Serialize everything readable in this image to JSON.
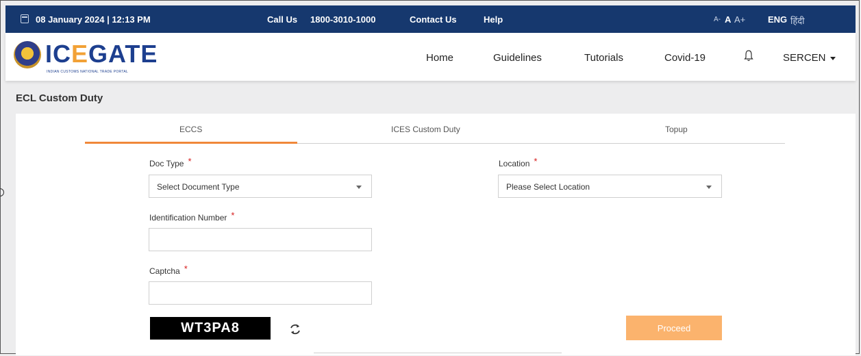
{
  "topbar": {
    "datetime": "08 January 2024 | 12:13 PM",
    "call_label": "Call Us",
    "call_number": "1800-3010-1000",
    "contact": "Contact Us",
    "help": "Help",
    "font_small": "A-",
    "font_normal": "A",
    "font_large": "A+",
    "lang_en": "ENG",
    "lang_hi": "हिंदी"
  },
  "logo": {
    "text_ic": "IC",
    "text_e": "E",
    "text_rest": "GATE",
    "subtitle": "INDIAN CUSTOMS NATIONAL TRADE PORTAL"
  },
  "nav": {
    "items": [
      "Home",
      "Guidelines",
      "Tutorials",
      "Covid-19"
    ],
    "user": "SERCEN"
  },
  "page": {
    "title": "ECL Custom Duty"
  },
  "tabs": [
    {
      "label": "ECCS",
      "active": true
    },
    {
      "label": "ICES Custom Duty",
      "active": false
    },
    {
      "label": "Topup",
      "active": false
    }
  ],
  "form": {
    "doc_type_label": "Doc Type",
    "doc_type_value": "Select Document Type",
    "location_label": "Location",
    "location_value": "Please Select Location",
    "id_label": "Identification Number",
    "id_value": "",
    "captcha_label": "Captcha",
    "captcha_value": "",
    "required_mark": "*",
    "captcha_image_text": "WT3PA8",
    "proceed_label": "Proceed"
  },
  "colors": {
    "topbar_bg": "#16386e",
    "accent": "#f0883a",
    "proceed_bg": "#fbb36d",
    "required": "#d61c1c"
  }
}
